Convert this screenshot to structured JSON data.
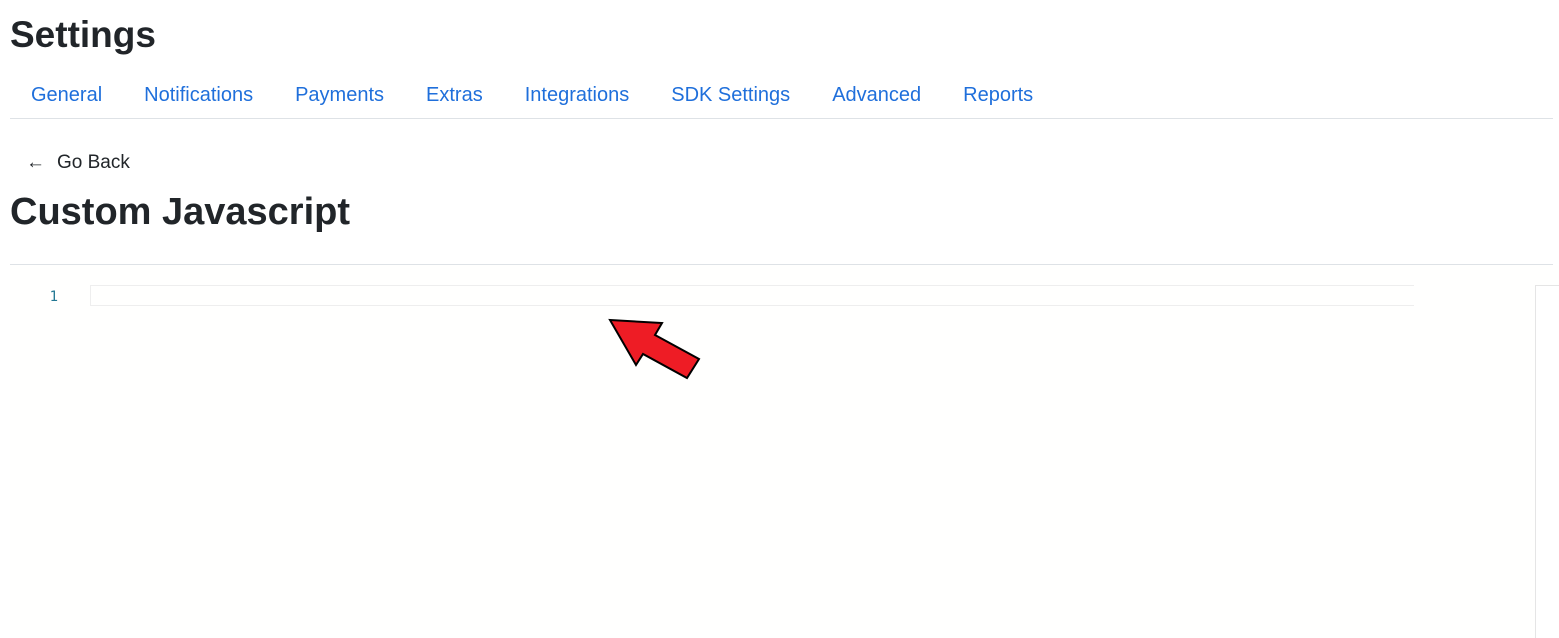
{
  "page": {
    "title": "Settings"
  },
  "tabs": [
    {
      "label": "General"
    },
    {
      "label": "Notifications"
    },
    {
      "label": "Payments"
    },
    {
      "label": "Extras"
    },
    {
      "label": "Integrations"
    },
    {
      "label": "SDK Settings"
    },
    {
      "label": "Advanced"
    },
    {
      "label": "Reports"
    }
  ],
  "back": {
    "icon": "arrow-left-icon",
    "glyph": "←",
    "label": "Go Back"
  },
  "section": {
    "title": "Custom Javascript"
  },
  "editor": {
    "line_numbers": [
      "1"
    ],
    "value": ""
  },
  "colors": {
    "tab_link": "#1f6fdb",
    "annotation_arrow": "#ee1c25"
  }
}
